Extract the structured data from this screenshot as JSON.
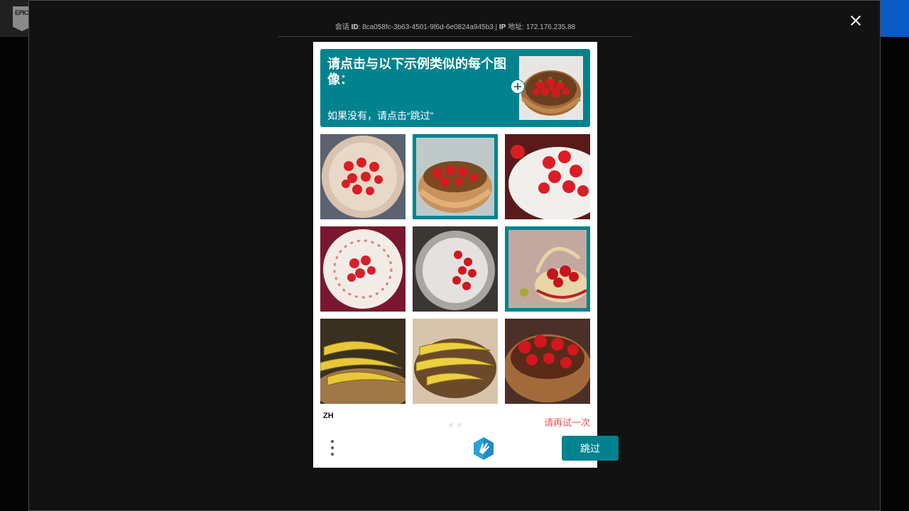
{
  "session": {
    "id_prefix": "会话",
    "id_label": "ID",
    "id_value": "8ca058fc-3b63-4501-9f6d-6e0824a945b3",
    "separator": "|",
    "ip_label": "IP",
    "ip_suffix": "地址",
    "ip_value": "172.176.235.88"
  },
  "captcha": {
    "prompt_title": "请点击与以下示例类似的每个图像：",
    "prompt_subtitle": "如果没有，请点击“跳过”",
    "language": "ZH",
    "error_text": "请再试一次",
    "verify_label": "跳过",
    "pager_count": 2,
    "tiles": [
      {
        "content": "strawberries on plate",
        "selected": false
      },
      {
        "content": "strawberries in basket",
        "selected": true
      },
      {
        "content": "strawberries on plate",
        "selected": false
      },
      {
        "content": "strawberries on decorated plate",
        "selected": false
      },
      {
        "content": "strawberries on plate",
        "selected": false
      },
      {
        "content": "strawberries in basket",
        "selected": true
      },
      {
        "content": "bananas in basket",
        "selected": false
      },
      {
        "content": "bananas in basket",
        "selected": false
      },
      {
        "content": "strawberries in basket",
        "selected": false
      }
    ]
  },
  "colors": {
    "accent": "#00838f",
    "error": "#ee5555",
    "modal_bg": "#121212",
    "header_bg": "#202020",
    "cta_blue": "#0a5bc7"
  },
  "icons": {
    "close": "close-icon",
    "add": "add-icon",
    "menu": "more-vertical-icon",
    "brand": "hcaptcha-logo-icon",
    "site": "epic-games-logo-icon"
  }
}
